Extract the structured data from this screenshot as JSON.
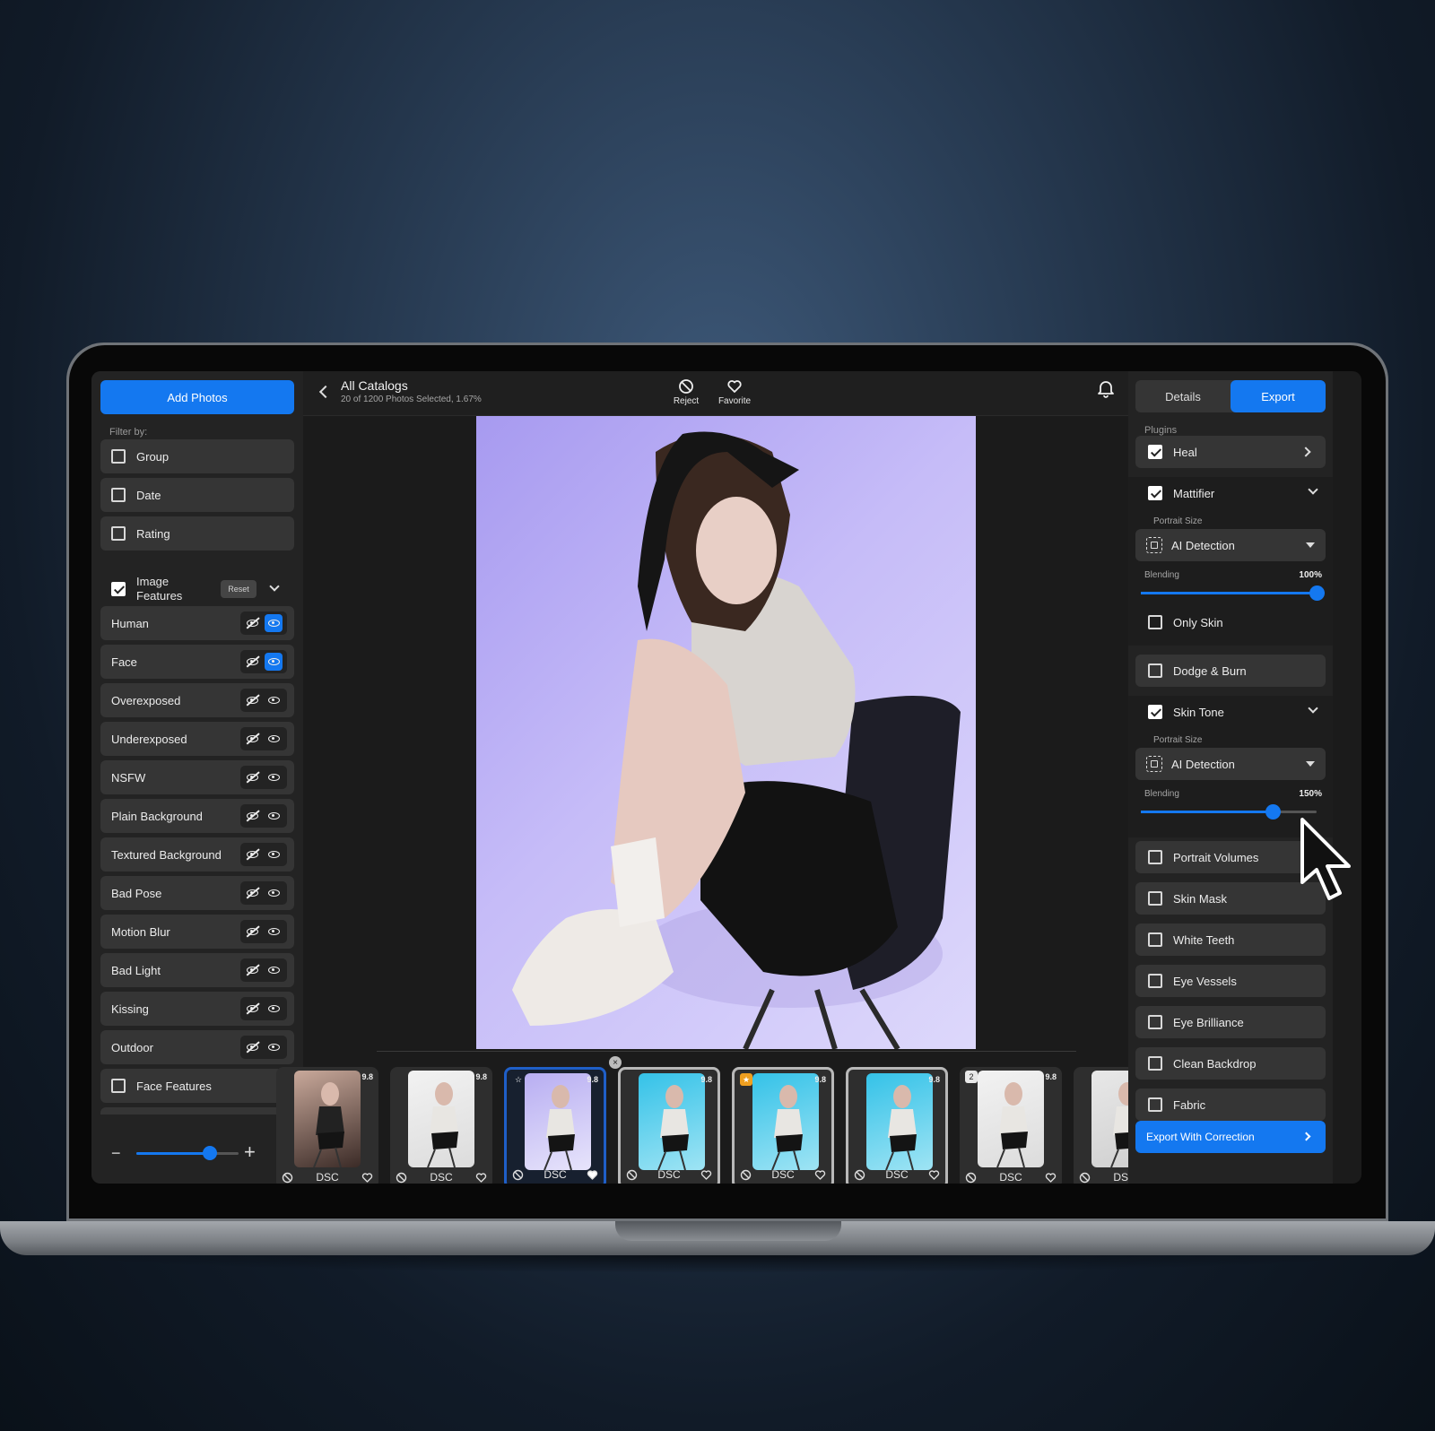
{
  "left_panel": {
    "add_photos_label": "Add Photos",
    "filter_by_label": "Filter by:",
    "filters": [
      {
        "label": "Group",
        "checked": false
      },
      {
        "label": "Date",
        "checked": false
      },
      {
        "label": "Rating",
        "checked": false
      }
    ],
    "image_features": {
      "label": "Image Features",
      "checked": true,
      "reset_label": "Reset",
      "expanded": true
    },
    "features": [
      {
        "label": "Human",
        "view_on": true
      },
      {
        "label": "Face",
        "view_on": true
      },
      {
        "label": "Overexposed",
        "view_on": false
      },
      {
        "label": "Underexposed",
        "view_on": false
      },
      {
        "label": "NSFW",
        "view_on": false
      },
      {
        "label": "Plain Background",
        "view_on": false
      },
      {
        "label": "Textured Background",
        "view_on": false
      },
      {
        "label": "Bad Pose",
        "view_on": false
      },
      {
        "label": "Motion Blur",
        "view_on": false
      },
      {
        "label": "Bad Light",
        "view_on": false
      },
      {
        "label": "Kissing",
        "view_on": false
      },
      {
        "label": "Outdoor",
        "view_on": false
      }
    ],
    "face_features": {
      "label": "Face Features",
      "checked": false
    },
    "zoom": {
      "minus": "−",
      "plus": "+",
      "level": 0.72
    }
  },
  "topbar": {
    "title": "All Catalogs",
    "subtitle": "20 of 1200 Photos Selected, 1.67%",
    "reject_label": "Reject",
    "favorite_label": "Favorite"
  },
  "filmstrip": {
    "thumbs": [
      {
        "name": "DSC",
        "score": "9.8",
        "state": "normal",
        "bg": "dark"
      },
      {
        "name": "DSC",
        "score": "9.8",
        "state": "normal",
        "bg": "white"
      },
      {
        "name": "DSC",
        "score": "9.8",
        "state": "selected",
        "bg": "lavender",
        "badge": "☆"
      },
      {
        "name": "DSC",
        "score": "9.8",
        "state": "group",
        "bg": "cyan"
      },
      {
        "name": "DSC",
        "score": "9.8",
        "state": "group",
        "bg": "cyan",
        "badge": "★"
      },
      {
        "name": "DSC",
        "score": "9.8",
        "state": "group",
        "bg": "cyan"
      },
      {
        "name": "DSC",
        "score": "9.8",
        "state": "normal",
        "bg": "white",
        "badge": "2"
      },
      {
        "name": "DSC",
        "score": "",
        "state": "normal",
        "bg": "grey"
      }
    ],
    "close_label": "×"
  },
  "right_panel": {
    "tabs": [
      "Details",
      "Export"
    ],
    "active_tab": "Export",
    "plugins_label": "Plugins",
    "heal": {
      "label": "Heal",
      "checked": true
    },
    "mattifier": {
      "label": "Mattifier",
      "checked": true,
      "portrait_size_label": "Portrait Size",
      "dropdown_value": "AI Detection",
      "blending_label": "Blending",
      "blending_value": "100%",
      "blending_fraction": 1.0,
      "only_skin_label": "Only Skin"
    },
    "dodge_burn": {
      "label": "Dodge & Burn",
      "checked": false
    },
    "skin_tone": {
      "label": "Skin Tone",
      "checked": true,
      "portrait_size_label": "Portrait Size",
      "dropdown_value": "AI Detection",
      "blending_label": "Blending",
      "blending_value": "150%",
      "blending_fraction": 0.75
    },
    "others": [
      {
        "label": "Portrait Volumes"
      },
      {
        "label": "Skin Mask"
      },
      {
        "label": "White Teeth"
      },
      {
        "label": "Eye Vessels"
      },
      {
        "label": "Eye Brilliance"
      },
      {
        "label": "Clean Backdrop"
      },
      {
        "label": "Fabric"
      }
    ],
    "export_button": "Export With Correction"
  },
  "colors": {
    "accent": "#1478f0",
    "panel": "#232323",
    "row": "#353535"
  }
}
